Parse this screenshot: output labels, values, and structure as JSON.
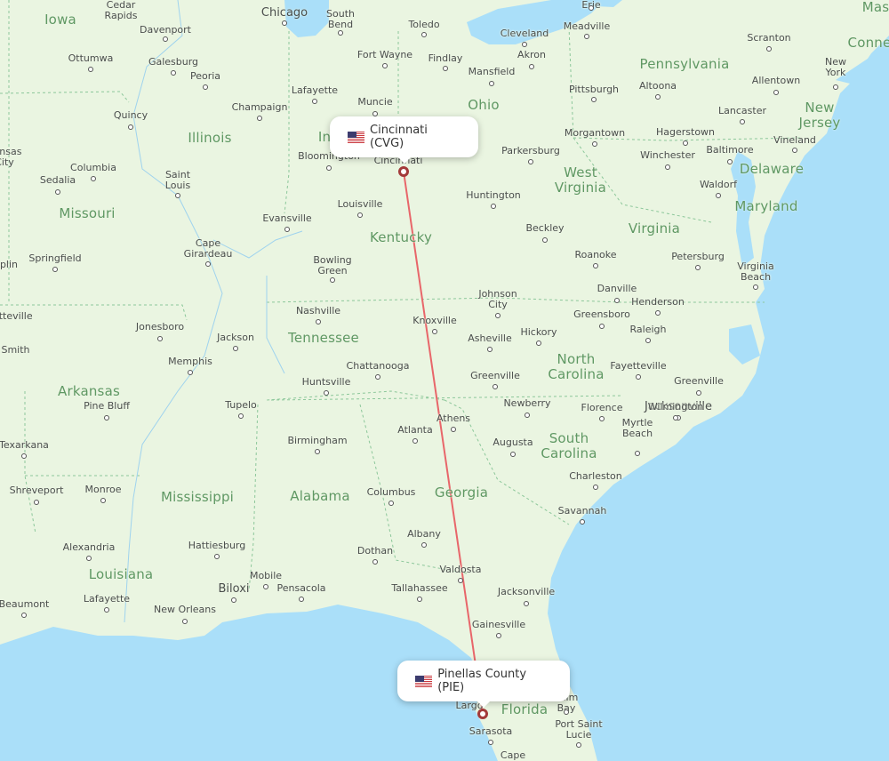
{
  "map": {
    "colors": {
      "water": "#aadff9",
      "land": "#eaf5e1",
      "route": "#e8666a",
      "marker": "#a33a3a",
      "state_label": "#5f9863"
    },
    "origin": {
      "label": "Cincinnati (CVG)",
      "flag": "us-flag-icon"
    },
    "destination": {
      "label": "Pinellas County (PIE)",
      "flag": "us-flag-icon"
    },
    "states": [
      "Iowa",
      "Illinois",
      "Missouri",
      "Kentucky",
      "Tennessee",
      "Arkansas",
      "Mississippi",
      "Alabama",
      "Georgia",
      "Louisiana",
      "Florida",
      "South\nCarolina",
      "North\nCarolina",
      "Virginia",
      "West\nVirginia",
      "Ohio",
      "Pennsylvania",
      "Maryland",
      "Delaware",
      "New\nJersey",
      "Conne",
      "Mas",
      "In"
    ],
    "cities": [
      "Cedar\nRapids",
      "Davenport",
      "Chicago",
      "South\nBend",
      "Toledo",
      "Cleveland",
      "Meadville",
      "Ottumwa",
      "Galesburg",
      "Peoria",
      "Fort Wayne",
      "Findlay",
      "Akron",
      "Mansfield",
      "Lafayette",
      "Muncie",
      "Champaign",
      "Quincy",
      "Pittsburgh",
      "Altoona",
      "Scranton",
      "Allentown",
      "New\nYork",
      "Lancaster",
      "Hagerstown",
      "Baltimore",
      "Vineland",
      "Morgantown",
      "Winchester",
      "Parkersburg",
      "Bloomington",
      "Cincinnati",
      "Columbia",
      "Saint\nLouis",
      "Sedalia",
      "Huntington",
      "Waldorf",
      "Evansville",
      "Louisville",
      "Beckley",
      "Cape\nGirardeau",
      "Springfield",
      "Roanoke",
      "Petersburg",
      "Bowling\nGreen",
      "Virginia\nBeach",
      "Johnson\nCity",
      "Danville",
      "Henderson",
      "Nashville",
      "Knoxville",
      "Greensboro",
      "Asheville",
      "Hickory",
      "Raleigh",
      "Greenville",
      "Jonesboro",
      "Jackson",
      "Memphis",
      "Fayetteville",
      "Chattanooga",
      "Huntsville",
      "Greenville",
      "Jacksonville",
      "Pine Bluff",
      "Tupelo",
      "Newberry",
      "Florence",
      "Wilmington",
      "Athens",
      "Atlanta",
      "Myrtle\nBeach",
      "Texarkana",
      "Birmingham",
      "Augusta",
      "Charleston",
      "Shreveport",
      "Monroe",
      "Columbus",
      "Savannah",
      "Albany",
      "Alexandria",
      "Hattiesburg",
      "Dothan",
      "Valdosta",
      "Mobile",
      "Jacksonville",
      "Lafayette",
      "Biloxi",
      "Pensacola",
      "Tallahassee",
      "Beaumont",
      "New Orleans",
      "Gainesville",
      "Largo",
      "Palm\nBay",
      "Sarasota",
      "Port Saint\nLucie",
      "Cape",
      "Fayetteville",
      "Fort Smith",
      "Joplin",
      "Kansas\nCity",
      "Erie"
    ]
  }
}
